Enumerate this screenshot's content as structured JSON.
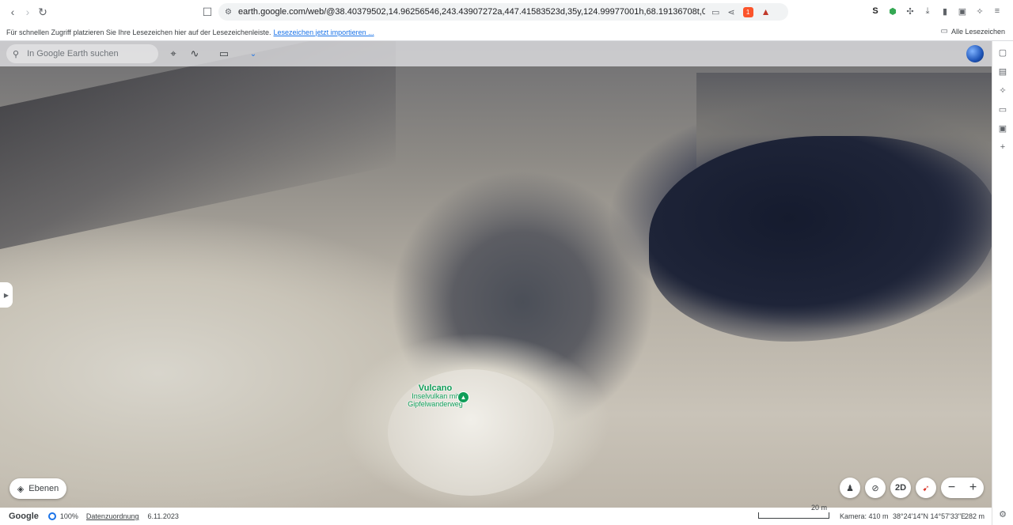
{
  "browser": {
    "url": "earth.google.com/web/@38.40379502,14.96256546,243.43907272a,447.41583523d,35y,124.99977001h,68.19136708t,0r/data=CgRCAgg...",
    "bookmarks_bar_text": "Für schnellen Zugriff platzieren Sie Ihre Lesezeichen hier auf der Lesezeichenleiste.",
    "bookmarks_import_link": "Lesezeichen jetzt importieren ...",
    "all_bookmarks": "Alle Lesezeichen",
    "shield_badge": "1"
  },
  "earth": {
    "search_placeholder": "In Google Earth suchen",
    "layers_label": "Ebenen",
    "mode_2d": "2D",
    "poi": {
      "title": "Vulcano",
      "subtitle": "Inselvulkan mit Gipfelwanderweg"
    }
  },
  "status": {
    "brand": "Google",
    "progress": "100%",
    "attribution": "Datenzuordnung",
    "date": "6.11.2023",
    "scale": "20 m",
    "camera": "Kamera: 410 m",
    "coords": "38°24'14\"N 14°57'33\"E",
    "elevation": "282 m"
  },
  "colors": {
    "accent": "#1a73e8",
    "poi_green": "#0f9d58"
  }
}
